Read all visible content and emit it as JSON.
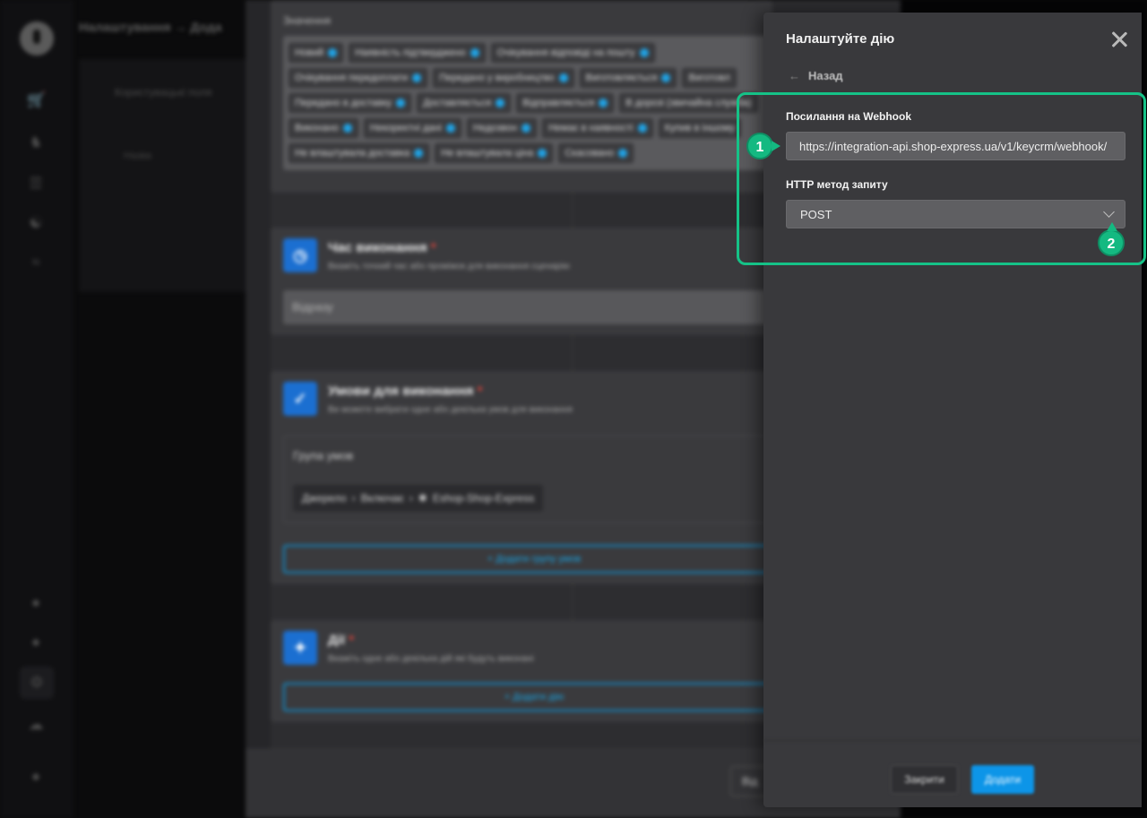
{
  "background": {
    "breadcrumb": "Налаштування → Дода",
    "page_panel_title": "Користувацькі поля",
    "page_panel_item": "Назва",
    "values_label": "Значення",
    "tag_rows": [
      [
        "Новий",
        "Наявність підтверджено",
        "Очікування відповіді на пошту"
      ],
      [
        "Очікування передоплати",
        "Передано у виробництво",
        "Виготовляється",
        "Виготовл"
      ],
      [
        "Передано в доставку",
        "Доставляється",
        "Відправляється",
        "В дорозі (звичайна служба)"
      ],
      [
        "Виконано",
        "Некоректні дані",
        "Недозвон",
        "Немає в наявності",
        "Купив в іншому"
      ],
      [
        "Не влаштувала доставка",
        "Не влаштувала ціна",
        "Скасовано"
      ]
    ],
    "time_section": {
      "icon": "clock-icon",
      "title": "Час виконання",
      "required_mark": "*",
      "subtitle": "Вкажіть точний час або проміжок для виконання сценарію",
      "value": "Відразу"
    },
    "conditions_section": {
      "icon": "checkbox-icon",
      "title": "Умови для виконання",
      "required_mark": "*",
      "subtitle": "Ви можете вибрати одне або декілька умов для виконання",
      "group_label": "Група умов",
      "chip_source": "Джерело",
      "chip_op": "Включає",
      "chip_value": "Eshop-Shop-Express",
      "add_group_button": "+ Додати групу умов"
    },
    "actions_section": {
      "icon": "lightning-icon",
      "title": "Дії",
      "required_mark": "*",
      "subtitle": "Вкажіть одне або декілька дій які будуть виконані",
      "add_action_button": "+ Додати дію"
    },
    "footer_button": "Від"
  },
  "drawer": {
    "title": "Налаштуйте дію",
    "back_label": "Назад",
    "webhook_label": "Посилання на Webhook",
    "webhook_value": "https://integration-api.shop-express.ua/v1/keycrm/webhook/",
    "method_label": "HTTP метод запиту",
    "method_value": "POST",
    "close_button": "Закрити",
    "add_button": "Додати"
  },
  "annotations": {
    "marker_1": "1",
    "marker_2": "2"
  },
  "colors": {
    "accent_green": "#15c287",
    "primary_blue": "#0d95e8",
    "panel_bg": "#39393c"
  }
}
